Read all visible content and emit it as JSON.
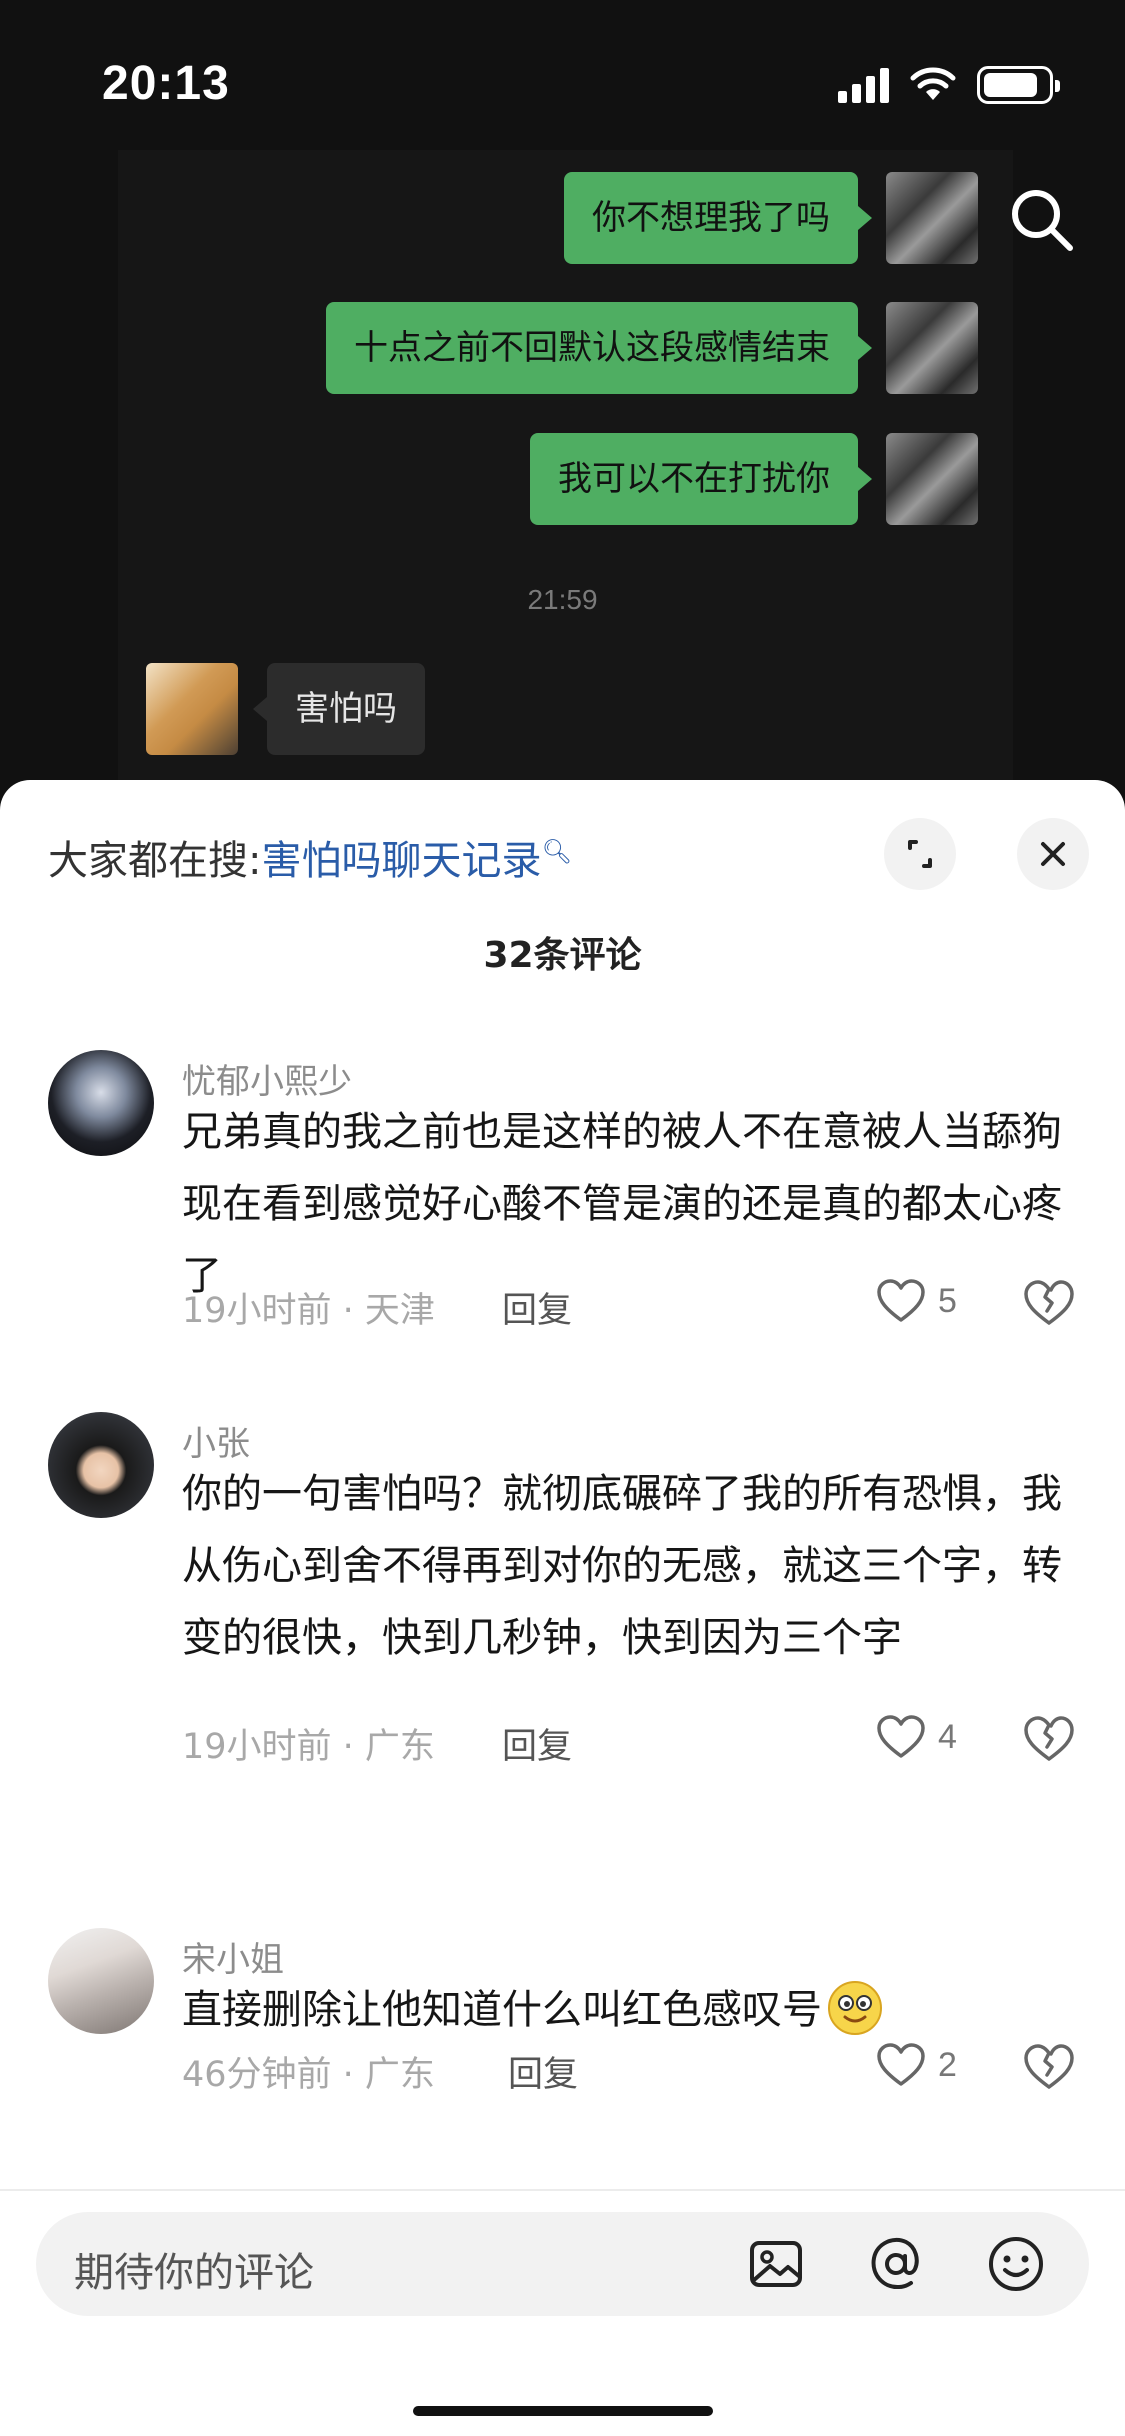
{
  "status_bar": {
    "time": "20:13",
    "battery_percent": 85
  },
  "chat": {
    "messages": [
      {
        "from": "me",
        "text": "你不想理我了吗"
      },
      {
        "from": "me",
        "text": "十点之前不回默认这段感情结束"
      },
      {
        "from": "me",
        "text": "我可以不在打扰你"
      },
      {
        "from": "other",
        "text": "害怕吗"
      }
    ],
    "timestamp": "21:59"
  },
  "sheet": {
    "hot_search_prefix": "大家都在搜:",
    "hot_search_keyword": "害怕吗聊天记录",
    "comment_count": "32条评论",
    "comments": [
      {
        "username": "忧郁小熙少",
        "text": "兄弟真的我之前也是这样的被人不在意被人当舔狗现在看到感觉好心酸不管是演的还是真的都太心疼了",
        "time": "19小时前 · 天津",
        "reply_label": "回复",
        "likes": "5"
      },
      {
        "username": "小张",
        "text": "你的一句害怕吗？就彻底碾碎了我的所有恐惧，我从伤心到舍不得再到对你的无感，就这三个字，转变的很快，快到几秒钟，快到因为三个字",
        "time": "19小时前 · 广东",
        "reply_label": "回复",
        "likes": "4"
      },
      {
        "username": "宋小姐",
        "text": "直接删除让他知道什么叫红色感叹号",
        "time": "46分钟前 · 广东",
        "reply_label": "回复",
        "likes": "2"
      }
    ],
    "input_placeholder": "期待你的评论"
  },
  "colors": {
    "my_bubble": "#4fae62",
    "hot_search_keyword": "#2a5ca8",
    "sheet_bg": "#ffffff"
  },
  "icons": [
    "search-icon",
    "expand-icon",
    "close-icon",
    "heart-icon",
    "broken-heart-icon",
    "image-icon",
    "at-icon",
    "emoji-icon"
  ]
}
